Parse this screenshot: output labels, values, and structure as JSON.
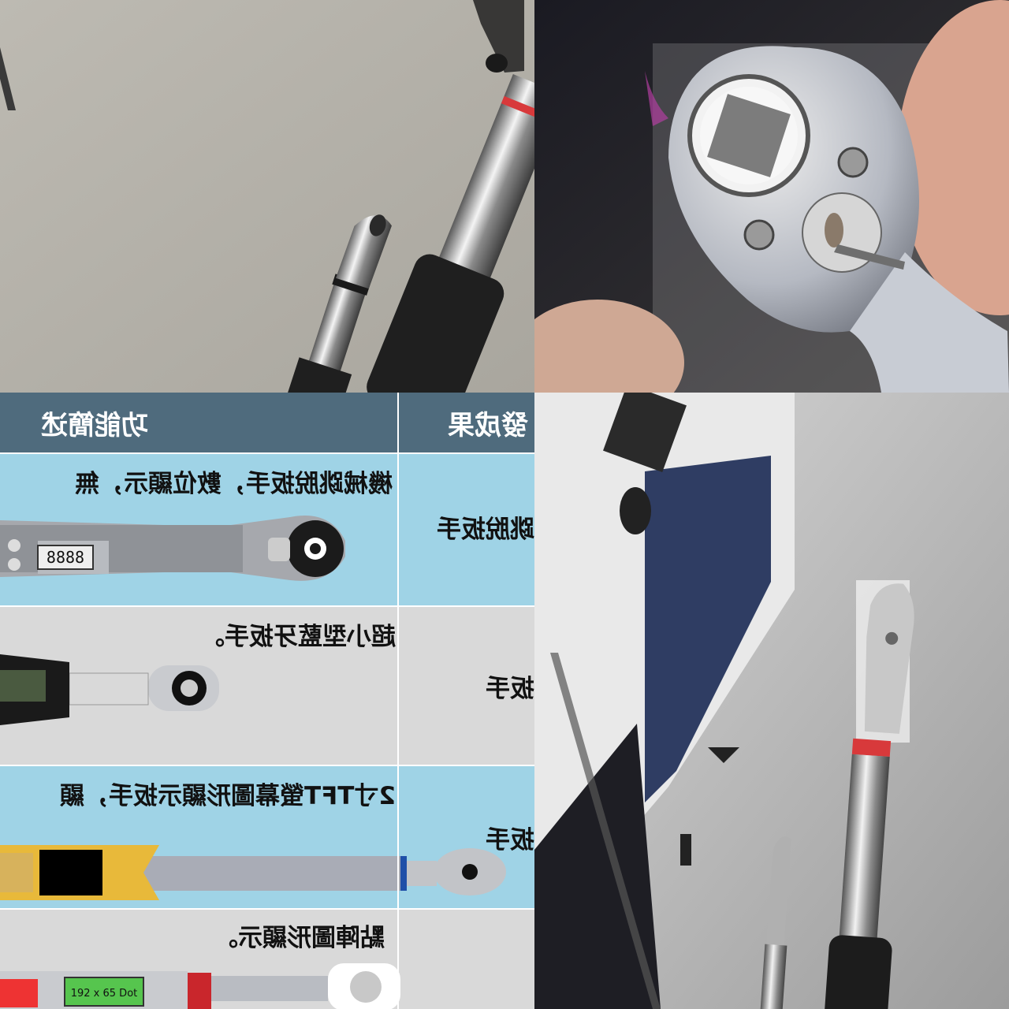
{
  "collage": {
    "top_left": {
      "subject": "torque wrench ratchet heads on concrete floor"
    },
    "top_right": {
      "subject": "close-up of chrome ratchet head with square drive"
    },
    "bottom_right": {
      "subject": "two torque wrenches on office floor"
    }
  },
  "table": {
    "header_function": "功能簡述",
    "header_result": "發成果",
    "rows": [
      {
        "desc": "機械跳脫扳手，數位顯示，無",
        "name": "跳脫扳手",
        "lcd": "8888"
      },
      {
        "desc": "超小型藍牙扳手。",
        "name": "扳手"
      },
      {
        "desc": "2寸TFT螢幕圖形顯示扳手，顯",
        "name": "扳手"
      },
      {
        "desc": "點陣圖形顯示。",
        "name": "",
        "lcd": "192 x 65 Dot"
      }
    ]
  },
  "colors": {
    "table_header": "#4f6b7d",
    "row_blue": "#9fd3e6",
    "row_gray": "#d9d9d9",
    "red_band": "#d8393b"
  }
}
